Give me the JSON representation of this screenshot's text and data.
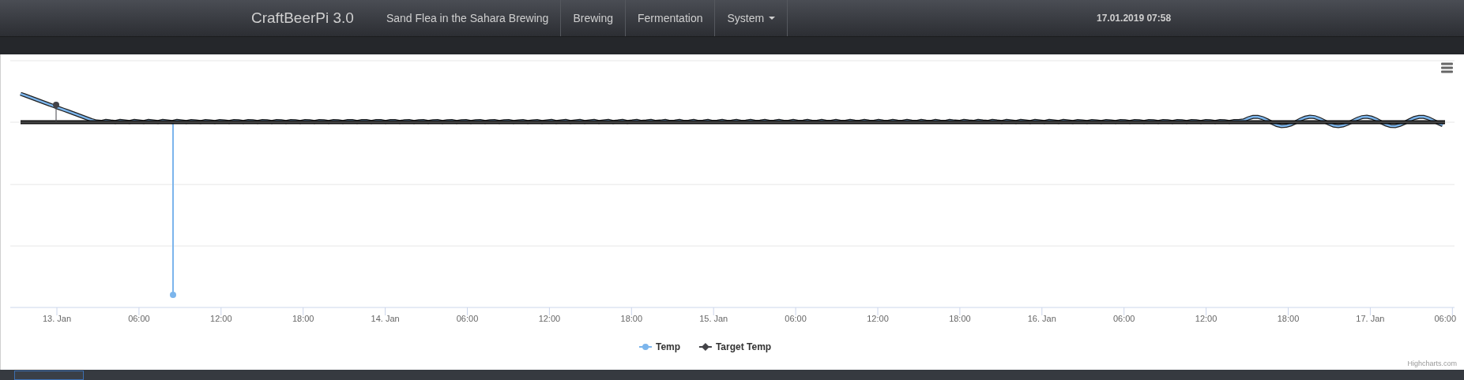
{
  "navbar": {
    "brand": "CraftBeerPi 3.0",
    "items": [
      {
        "label": "Sand Flea in the Sahara Brewing",
        "kind": "link"
      },
      {
        "label": "Brewing",
        "kind": "link"
      },
      {
        "label": "Fermentation",
        "kind": "link"
      },
      {
        "label": "System",
        "kind": "dropdown"
      }
    ],
    "clock": "17.01.2019 07:58"
  },
  "chart": {
    "x_labels": [
      "13. Jan",
      "06:00",
      "12:00",
      "18:00",
      "14. Jan",
      "06:00",
      "12:00",
      "18:00",
      "15. Jan",
      "06:00",
      "12:00",
      "18:00",
      "16. Jan",
      "06:00",
      "12:00",
      "18:00",
      "17. Jan",
      "06:00"
    ],
    "legend": [
      {
        "name": "Temp",
        "color": "#7cb5ec",
        "kind": "circle"
      },
      {
        "name": "Target Temp",
        "color": "#434348",
        "kind": "diamond"
      }
    ],
    "credit": "Highcharts.com"
  }
}
